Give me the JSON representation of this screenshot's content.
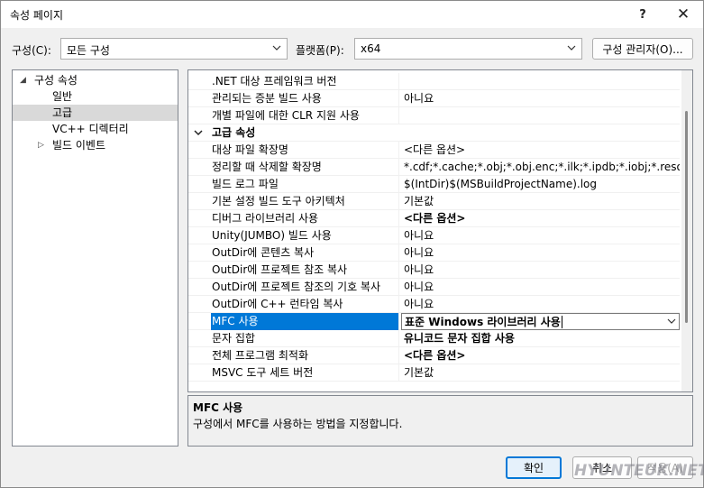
{
  "window": {
    "title": "속성 페이지",
    "help_label": "?",
    "close_label": "✕"
  },
  "toolbar": {
    "config_label": "구성(C):",
    "config_value": "모든 구성",
    "platform_label": "플랫폼(P):",
    "platform_value": "x64",
    "manager_label": "구성 관리자(O)..."
  },
  "tree": {
    "items": [
      {
        "label": "구성 속성"
      },
      {
        "label": "일반"
      },
      {
        "label": "고급"
      },
      {
        "label": "VC++ 디렉터리"
      },
      {
        "label": "빌드 이벤트"
      }
    ]
  },
  "grid": {
    "rows": [
      {
        "name": ".NET 대상 프레임워크 버전",
        "value": ""
      },
      {
        "name": "관리되는 증분 빌드 사용",
        "value": "아니요"
      },
      {
        "name": "개별 파일에 대한 CLR 지원 사용",
        "value": ""
      },
      {
        "name": "고급 속성",
        "value": ""
      },
      {
        "name": "대상 파일 확장명",
        "value": "<다른 옵션>"
      },
      {
        "name": "정리할 때 삭제할 확장명",
        "value": "*.cdf;*.cache;*.obj;*.obj.enc;*.ilk;*.ipdb;*.iobj;*.resources;*.t"
      },
      {
        "name": "빌드 로그 파일",
        "value": "$(IntDir)$(MSBuildProjectName).log"
      },
      {
        "name": "기본 설정 빌드 도구 아키텍처",
        "value": "기본값"
      },
      {
        "name": "디버그 라이브러리 사용",
        "value": "<다른 옵션>"
      },
      {
        "name": "Unity(JUMBO) 빌드 사용",
        "value": "아니요"
      },
      {
        "name": "OutDir에 콘텐츠 복사",
        "value": "아니요"
      },
      {
        "name": "OutDir에 프로젝트 참조 복사",
        "value": "아니요"
      },
      {
        "name": "OutDir에 프로젝트 참조의 기호 복사",
        "value": "아니요"
      },
      {
        "name": "OutDir에 C++ 런타임 복사",
        "value": "아니요"
      },
      {
        "name": "MFC 사용",
        "value": "표준 Windows 라이브러리 사용"
      },
      {
        "name": "문자 집합",
        "value": "유니코드 문자 집합 사용"
      },
      {
        "name": "전체 프로그램 최적화",
        "value": "<다른 옵션>"
      },
      {
        "name": "MSVC 도구 세트 버전",
        "value": "기본값"
      }
    ]
  },
  "description": {
    "title": "MFC 사용",
    "text": "구성에서 MFC를 사용하는 방법을 지정합니다."
  },
  "buttons": {
    "ok": "확인",
    "cancel": "취소",
    "apply": "적용(A)"
  },
  "watermark": "HYUNTEUK.NET",
  "colors": {
    "accent": "#0078d7",
    "selection_bg": "#0078d7",
    "tree_selection_bg": "#d9d9d9"
  }
}
